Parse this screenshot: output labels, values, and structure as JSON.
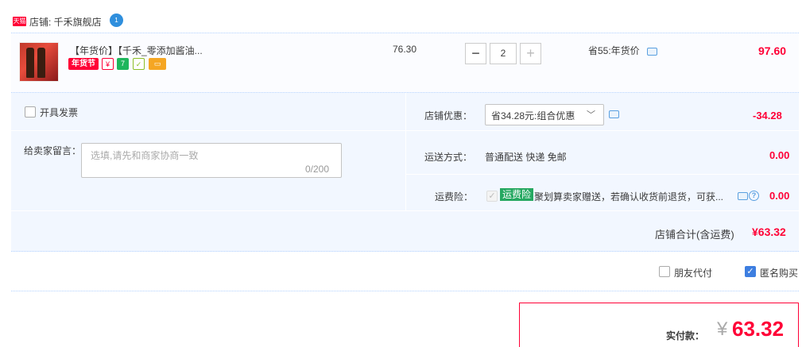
{
  "shop": {
    "badge": "天猫",
    "label": "店铺: 千禾旗舰店",
    "ww_badge": "1"
  },
  "item": {
    "title": "【年货价】【千禾_零添加酱油...",
    "tag_nianhuojie": "年货节",
    "unit_price": "76.30",
    "quantity": "2",
    "minus": "−",
    "plus": "+",
    "promo": "省55:年货价",
    "total": "97.60"
  },
  "options": {
    "invoice_label": "开具发票",
    "message_label": "给卖家留言：",
    "message_placeholder": "选填,请先和商家协商一致",
    "message_count": "0/200",
    "discount_label": "店铺优惠：",
    "discount_selected": "省34.28元:组合优惠",
    "discount_amount": "-34.28",
    "shipping_label": "运送方式：",
    "shipping_value": "普通配送 快递 免邮",
    "shipping_amount": "0.00",
    "insurance_label": "运费险：",
    "insurance_badge": "运费险",
    "insurance_desc": "聚划算卖家赠送，若确认收货前退货，可获...",
    "insurance_amount": "0.00",
    "shop_total_label": "店铺合计(含运费)",
    "shop_total_value": "¥63.32"
  },
  "footer": {
    "friend_pay_label": "朋友代付",
    "anonymous_label": "匿名购买",
    "anonymous_checked": true,
    "pay_label": "实付款：",
    "pay_currency": "¥",
    "pay_value": "63.32"
  },
  "colors": {
    "accent": "#ff0036",
    "panel": "#f2f7ff",
    "badge_green": "#26a861",
    "checkbox_blue": "#3d7ee0"
  }
}
